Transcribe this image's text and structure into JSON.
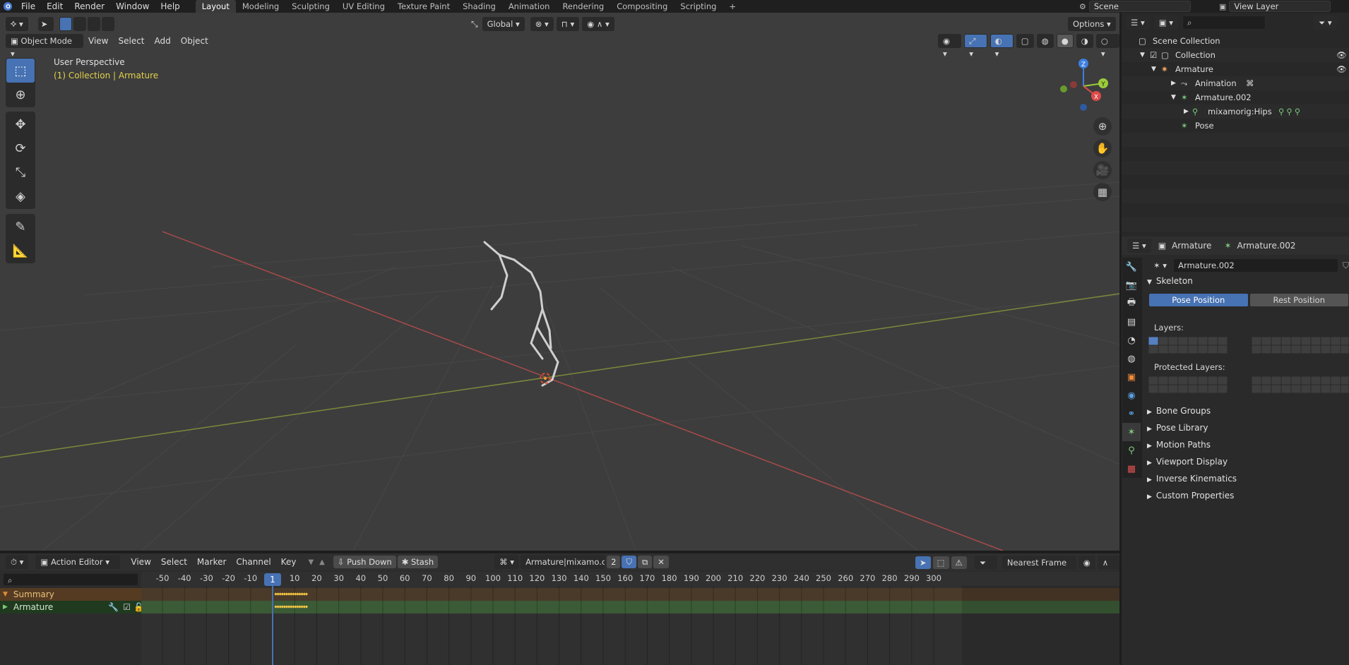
{
  "topbar": {
    "menus": [
      "File",
      "Edit",
      "Render",
      "Window",
      "Help"
    ],
    "workspaces": [
      "Layout",
      "Modeling",
      "Sculpting",
      "UV Editing",
      "Texture Paint",
      "Shading",
      "Animation",
      "Rendering",
      "Compositing",
      "Scripting"
    ],
    "add_tab": "+",
    "scene": "Scene",
    "view_layer": "View Layer"
  },
  "viewport": {
    "mode": "Object Mode",
    "menus": [
      "View",
      "Select",
      "Add",
      "Object"
    ],
    "orientation": "Global",
    "options": "Options",
    "overlay_title": "User Perspective",
    "overlay_sub": "(1) Collection | Armature",
    "gizmo": {
      "z": "Z",
      "y": "Y",
      "x": "X"
    }
  },
  "outliner": {
    "search_placeholder": "",
    "rows": [
      {
        "label": "Scene Collection",
        "indent": 0,
        "icon": "collection-icon"
      },
      {
        "label": "Collection",
        "indent": 1,
        "icon": "collection-icon"
      },
      {
        "label": "Armature",
        "indent": 2,
        "icon": "armature-object-icon"
      },
      {
        "label": "Animation",
        "indent": 3,
        "icon": "animation-icon"
      },
      {
        "label": "Armature.002",
        "indent": 3,
        "icon": "armature-data-icon"
      },
      {
        "label": "mixamorig:Hips",
        "indent": 4,
        "icon": "bone-icon"
      },
      {
        "label": "Pose",
        "indent": 3,
        "icon": "pose-icon"
      }
    ]
  },
  "properties": {
    "breadcrumb_object": "Armature",
    "breadcrumb_data": "Armature.002",
    "data_name": "Armature.002",
    "skeleton": "Skeleton",
    "pose_position": "Pose Position",
    "rest_position": "Rest Position",
    "layers_label": "Layers:",
    "protected_layers_label": "Protected Layers:",
    "panels": [
      "Bone Groups",
      "Pose Library",
      "Motion Paths",
      "Viewport Display",
      "Inverse Kinematics",
      "Custom Properties"
    ]
  },
  "dopesheet": {
    "editor": "Action Editor",
    "menus": [
      "View",
      "Select",
      "Marker",
      "Channel",
      "Key"
    ],
    "push_down": "Push Down",
    "stash": "Stash",
    "action_name": "Armature|mixamo.c...",
    "users": "2",
    "snap": "Nearest Frame",
    "current_frame": "1",
    "ticks": [
      "-50",
      "-40",
      "-30",
      "-20",
      "-10",
      "1",
      "10",
      "20",
      "30",
      "40",
      "50",
      "60",
      "70",
      "80",
      "90",
      "100",
      "110",
      "120",
      "130",
      "140",
      "150",
      "160",
      "170",
      "180",
      "190",
      "200",
      "210",
      "220",
      "230",
      "240",
      "250",
      "260",
      "270",
      "280",
      "290",
      "300"
    ],
    "channels": [
      "Summary",
      "Armature"
    ]
  },
  "colors": {
    "accent": "#4772b3",
    "summary_bg": "#553b22",
    "armature_bg": "#3b5a36",
    "key": "#f5c842"
  }
}
